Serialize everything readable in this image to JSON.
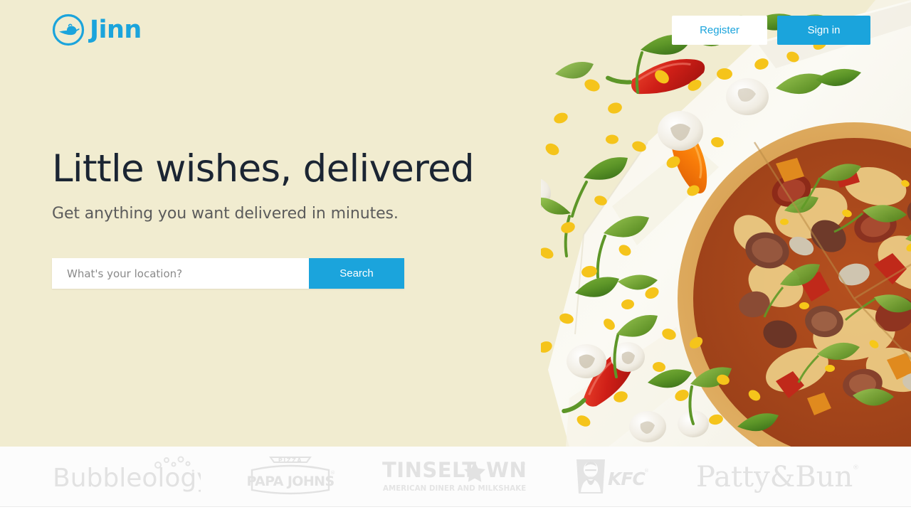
{
  "brand": {
    "name": "Jinn",
    "icon": "genie-lamp-icon",
    "color": "#1ba4dc"
  },
  "header": {
    "register_label": "Register",
    "signin_label": "Sign in"
  },
  "hero": {
    "headline": "Little wishes, delivered",
    "subhead": "Get anything you want delivered in minutes.",
    "background_color": "#f1ecd0",
    "headline_color": "#1b2533",
    "subhead_color": "#5b5b5b",
    "photo_description": "Overhead photo of a topped pizza on white parchment paper with rocket leaves, red and orange chilli peppers, sweetcorn kernels and sliced mushrooms scattered around"
  },
  "search": {
    "placeholder": "What's your location?",
    "value": "",
    "button_label": "Search",
    "accent_color": "#1ba4dc"
  },
  "partners": {
    "logos": [
      {
        "name": "Bubbleology",
        "text": "Bubbleology"
      },
      {
        "name": "Papa Johns Pizza",
        "top_text": "PIZZA",
        "text": "PAPA JOHNS"
      },
      {
        "name": "Tinseltown",
        "text": "TINSELT★WN",
        "registered": "®",
        "subtitle": "AMERICAN DINER AND MILKSHAKE BAR"
      },
      {
        "name": "KFC",
        "text": "KFC",
        "registered": "®"
      },
      {
        "name": "Patty & Bun",
        "text": "Patty&Bun",
        "registered": "®"
      }
    ],
    "logo_color": "#e0e0e0",
    "background_color": "#fcfcfc"
  }
}
